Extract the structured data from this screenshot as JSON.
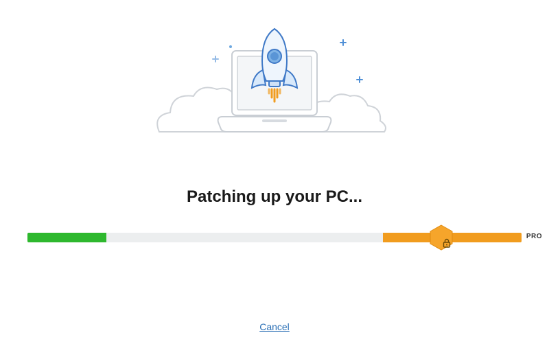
{
  "title": "Patching up your PC...",
  "progress": {
    "percent": 16,
    "pro_start_percent": 72
  },
  "pro_badge": {
    "label": "PRO",
    "icon": "lock-icon"
  },
  "cancel_label": "Cancel",
  "illustration": "rocket-laptop-clouds-icon",
  "colors": {
    "progress_green": "#2eb82e",
    "progress_orange": "#f19c1e",
    "track": "#eceeef",
    "link": "#2a6fb5"
  }
}
